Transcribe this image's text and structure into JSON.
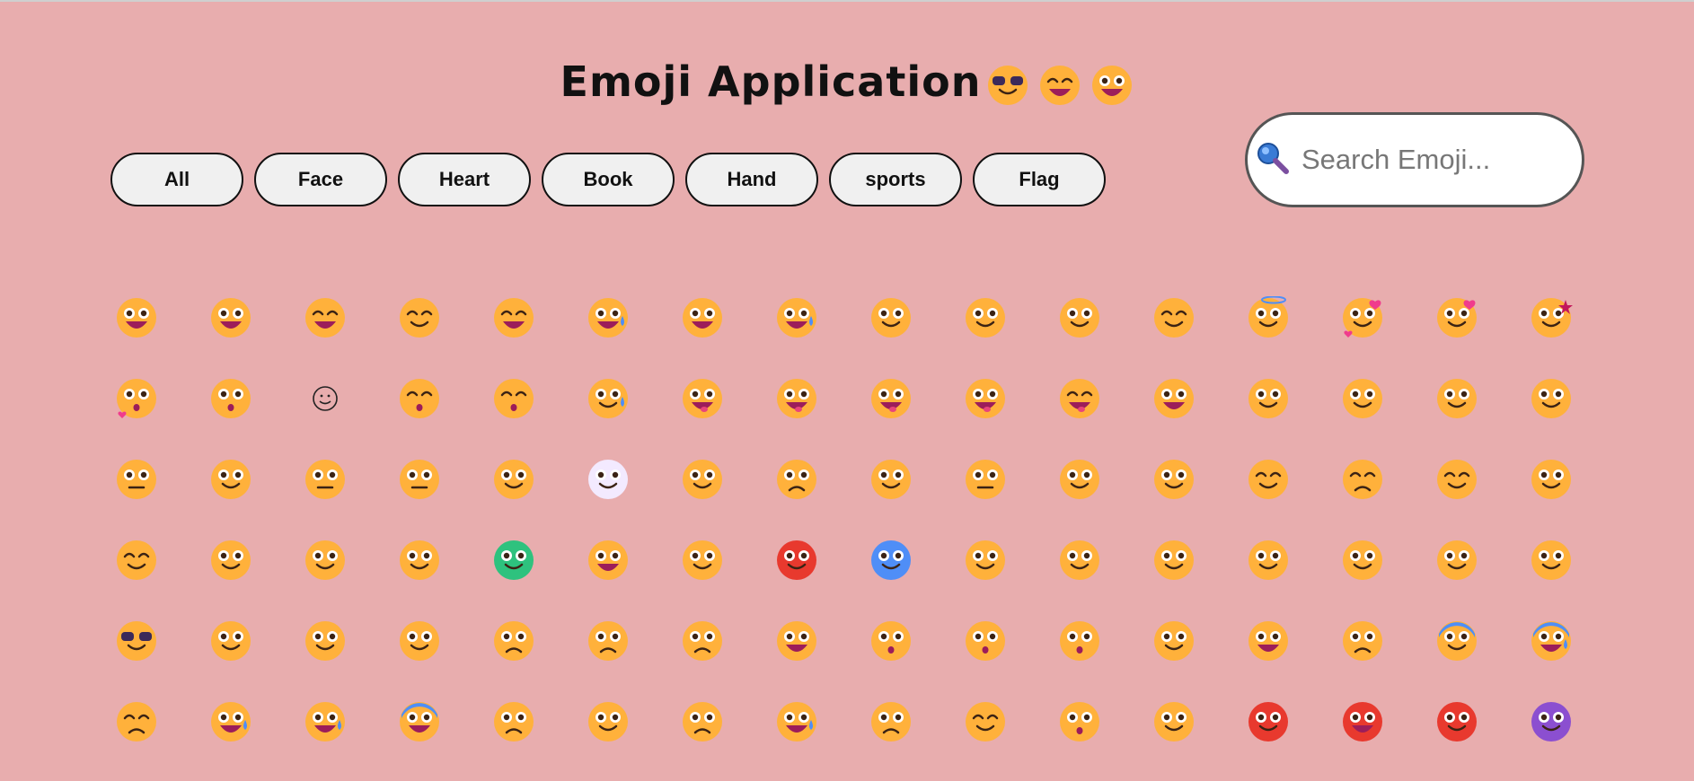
{
  "title": "Emoji Application",
  "header_icons": [
    "sunglasses-face-icon",
    "grinning-face-smiling-eyes-icon",
    "grinning-face-big-eyes-icon"
  ],
  "filters": [
    "All",
    "Face",
    "Heart",
    "Book",
    "Hand",
    "sports",
    "Flag"
  ],
  "search": {
    "placeholder": "Search Emoji...",
    "icon": "magnifier-icon"
  },
  "colors": {
    "background": "#e8adae",
    "face": "#ffb13b",
    "button_bg": "#f0f0f0"
  },
  "emoji_grid": [
    [
      "grinning-face-icon",
      "grinning-big-eyes-icon",
      "grinning-smiling-eyes-icon",
      "beaming-face-icon",
      "grinning-squinting-face-icon",
      "grinning-sweat-icon",
      "rolling-laughing-icon",
      "tears-of-joy-icon",
      "slightly-smiling-icon",
      "upside-down-face-icon",
      "winking-face-icon",
      "smiling-eyes-icon",
      "halo-face-icon",
      "hearts-face-icon",
      "heart-eyes-icon",
      "star-struck-icon"
    ],
    [
      "blowing-kiss-icon",
      "kissing-face-icon",
      "smiling-outline-icon",
      "kissing-closed-eyes-icon",
      "kissing-smiling-eyes-icon",
      "smiling-tear-icon",
      "yum-face-icon",
      "tongue-out-icon",
      "winking-tongue-icon",
      "zany-face-icon",
      "squinting-tongue-icon",
      "money-mouth-icon",
      "hugging-face-icon",
      "hand-over-mouth-icon",
      "open-eyes-hand-icon",
      "peeking-eye-icon"
    ],
    [
      "zipper-mouth-icon",
      "raised-eyebrow-icon",
      "neutral-face-icon",
      "expressionless-icon",
      "no-mouth-icon",
      "dotted-line-face-icon",
      "smirking-face-icon",
      "unamused-face-icon",
      "rolling-eyes-icon",
      "grimacing-face-icon",
      "exhaling-face-icon",
      "lying-face-icon",
      "relieved-face-icon",
      "pensive-face-icon",
      "sleepy-face-icon",
      "drooling-face-icon"
    ],
    [
      "sleeping-face-icon",
      "medical-mask-icon",
      "thermometer-face-icon",
      "bandage-face-icon",
      "nauseated-face-icon",
      "vomiting-face-icon",
      "sneezing-face-icon",
      "hot-face-icon",
      "cold-face-icon",
      "woozy-face-icon",
      "knocked-out-icon",
      "spiral-eyes-icon",
      "exploding-head-icon",
      "cowboy-face-icon",
      "partying-face-icon",
      "disguised-face-icon"
    ],
    [
      "cool-sunglasses-icon",
      "nerd-face-icon",
      "monocle-face-icon",
      "confused-face-icon",
      "worried-face-icon",
      "slightly-frowning-icon",
      "frowning-face-icon",
      "open-mouth-icon",
      "hushed-face-icon",
      "astonished-face-icon",
      "flushed-face-icon",
      "pleading-face-icon",
      "frowning-open-mouth-icon",
      "anguished-face-icon",
      "fearful-face-icon",
      "anxious-sweat-icon"
    ],
    [
      "sad-relieved-icon",
      "crying-face-icon",
      "loudly-crying-icon",
      "screaming-fear-icon",
      "confounded-face-icon",
      "persevering-face-icon",
      "disappointed-face-icon",
      "downcast-sweat-icon",
      "weary-face-icon",
      "tired-face-icon",
      "yawning-face-icon",
      "steam-nose-icon",
      "pouting-face-icon",
      "angry-face-icon",
      "cursing-face-icon",
      "smiling-horns-icon"
    ]
  ]
}
